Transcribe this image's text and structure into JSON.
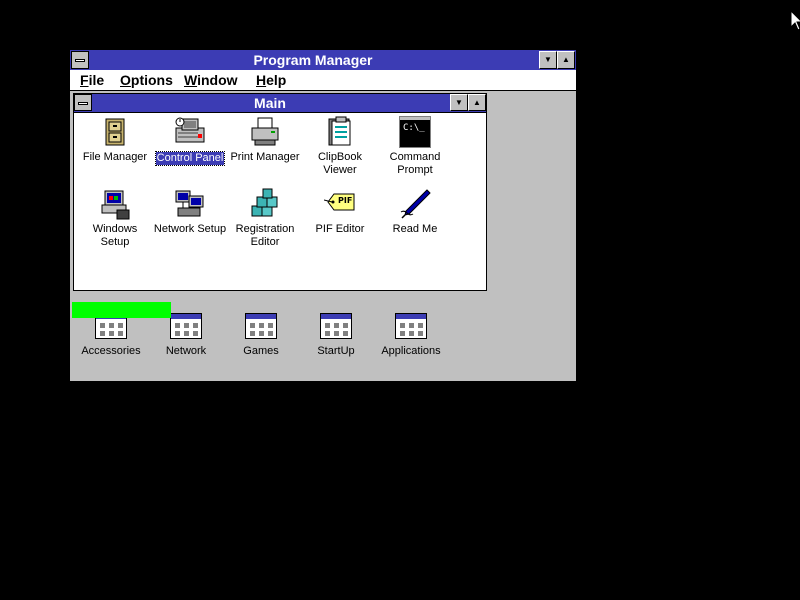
{
  "program_manager": {
    "title": "Program Manager",
    "menu": [
      {
        "accel": "F",
        "rest": "ile"
      },
      {
        "accel": "O",
        "rest": "ptions"
      },
      {
        "accel": "W",
        "rest": "indow"
      },
      {
        "accel": "H",
        "rest": "elp"
      }
    ]
  },
  "main_group": {
    "title": "Main",
    "icons": [
      {
        "label": "File Manager",
        "icon": "file-cabinet-icon"
      },
      {
        "label": "Control Panel",
        "icon": "control-panel-icon",
        "selected": true
      },
      {
        "label": "Print Manager",
        "icon": "printer-icon"
      },
      {
        "label": "ClipBook\nViewer",
        "icon": "clipbook-icon"
      },
      {
        "label": "Command\nPrompt",
        "icon": "command-prompt-icon"
      },
      {
        "label": "Windows\nSetup",
        "icon": "windows-setup-icon"
      },
      {
        "label": "Network Setup",
        "icon": "network-setup-icon"
      },
      {
        "label": "Registration\nEditor",
        "icon": "registry-cubes-icon"
      },
      {
        "label": "PIF Editor",
        "icon": "pif-tag-icon"
      },
      {
        "label": "Read Me",
        "icon": "pen-icon"
      }
    ],
    "command_prompt_text": "C:\\_",
    "pif_text": "PIF"
  },
  "groups": [
    {
      "label": "Accessories"
    },
    {
      "label": "Network"
    },
    {
      "label": "Games"
    },
    {
      "label": "StartUp"
    },
    {
      "label": "Applications"
    }
  ],
  "colors": {
    "title_active": "#3c3cb4",
    "desktop": "#000000",
    "face": "#c0c0c0",
    "highlight_bar": "#00ff00"
  }
}
